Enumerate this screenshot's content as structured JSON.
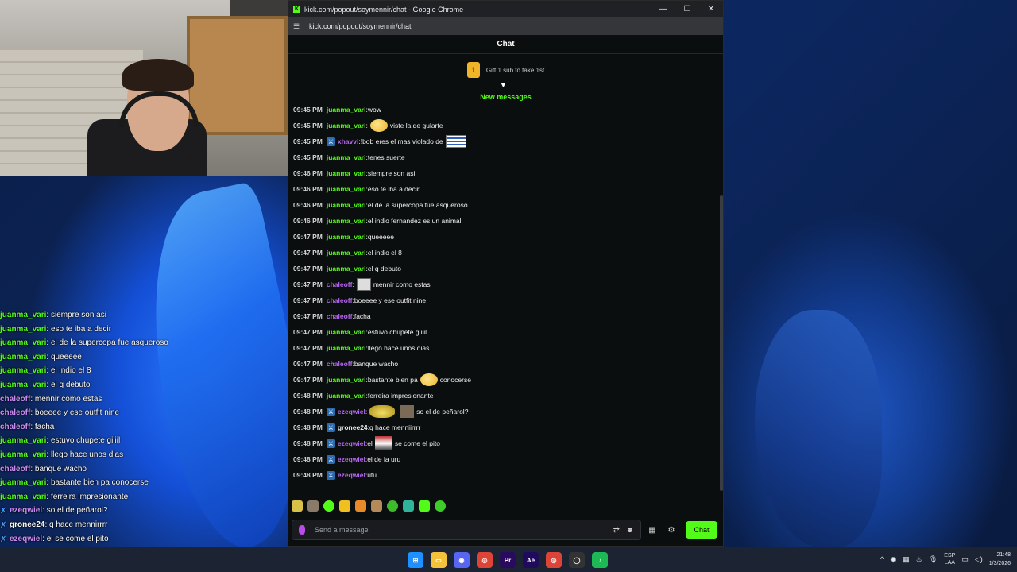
{
  "browser": {
    "title": "kick.com/popout/soymennir/chat - Google Chrome",
    "url": "kick.com/popout/soymennir/chat",
    "controls": {
      "minimize": "—",
      "maximize": "☐",
      "close": "✕"
    }
  },
  "chat": {
    "header": "Chat",
    "gift_rank": "1",
    "gift_text": "Gift 1 sub to take 1st",
    "new_messages": "New messages",
    "input_placeholder": "Send a message",
    "send_label": "Chat",
    "messages": [
      {
        "time": "09:45 PM",
        "user": "juanma_vari",
        "color": "#53fc18",
        "mod": false,
        "pre": "",
        "emote": "",
        "text": "wow"
      },
      {
        "time": "09:45 PM",
        "user": "juanma_vari",
        "color": "#53fc18",
        "mod": false,
        "pre": "",
        "emote": "blob",
        "text": "viste la de gularte"
      },
      {
        "time": "09:45 PM",
        "user": "xhavvi",
        "color": "#b565f0",
        "mod": true,
        "pre": "",
        "text": "!bob eres el mas violado de",
        "emote_after": "flag"
      },
      {
        "time": "09:45 PM",
        "user": "juanma_vari",
        "color": "#53fc18",
        "mod": false,
        "pre": "",
        "emote": "",
        "text": "tenes suerte"
      },
      {
        "time": "09:46 PM",
        "user": "juanma_vari",
        "color": "#53fc18",
        "mod": false,
        "pre": "",
        "emote": "",
        "text": "siempre son asi"
      },
      {
        "time": "09:46 PM",
        "user": "juanma_vari",
        "color": "#53fc18",
        "mod": false,
        "pre": "",
        "emote": "",
        "text": "eso te iba a decir"
      },
      {
        "time": "09:46 PM",
        "user": "juanma_vari",
        "color": "#53fc18",
        "mod": false,
        "pre": "",
        "emote": "",
        "text": "el de la supercopa fue asqueroso"
      },
      {
        "time": "09:46 PM",
        "user": "juanma_vari",
        "color": "#53fc18",
        "mod": false,
        "pre": "",
        "emote": "",
        "text": "el indio fernandez es un animal"
      },
      {
        "time": "09:47 PM",
        "user": "juanma_vari",
        "color": "#53fc18",
        "mod": false,
        "pre": "",
        "emote": "",
        "text": "queeeee"
      },
      {
        "time": "09:47 PM",
        "user": "juanma_vari",
        "color": "#53fc18",
        "mod": false,
        "pre": "",
        "emote": "",
        "text": "el indio el 8"
      },
      {
        "time": "09:47 PM",
        "user": "juanma_vari",
        "color": "#53fc18",
        "mod": false,
        "pre": "",
        "emote": "",
        "text": "el q debuto"
      },
      {
        "time": "09:47 PM",
        "user": "chaleoff",
        "color": "#b565f0",
        "mod": false,
        "pre": "",
        "emote": "cat",
        "text": "mennir como estas"
      },
      {
        "time": "09:47 PM",
        "user": "chaleoff",
        "color": "#b565f0",
        "mod": false,
        "pre": "",
        "emote": "",
        "text": "boeeee y ese outfit nine"
      },
      {
        "time": "09:47 PM",
        "user": "chaleoff",
        "color": "#b565f0",
        "mod": false,
        "pre": "",
        "emote": "",
        "text": "facha"
      },
      {
        "time": "09:47 PM",
        "user": "juanma_vari",
        "color": "#53fc18",
        "mod": false,
        "pre": "",
        "emote": "",
        "text": "estuvo chupete giiiil"
      },
      {
        "time": "09:47 PM",
        "user": "juanma_vari",
        "color": "#53fc18",
        "mod": false,
        "pre": "",
        "emote": "",
        "text": "llego hace unos dias"
      },
      {
        "time": "09:47 PM",
        "user": "chaleoff",
        "color": "#b565f0",
        "mod": false,
        "pre": "",
        "emote": "",
        "text": "banque wacho"
      },
      {
        "time": "09:47 PM",
        "user": "juanma_vari",
        "color": "#53fc18",
        "mod": false,
        "pre": "bastante bien pa",
        "emote": "blob",
        "text": "conocerse"
      },
      {
        "time": "09:48 PM",
        "user": "juanma_vari",
        "color": "#53fc18",
        "mod": false,
        "pre": "",
        "emote": "",
        "text": "ferreira impresionante"
      },
      {
        "time": "09:48 PM",
        "user": "ezeqwiel",
        "color": "#b565f0",
        "mod": true,
        "pre": "",
        "emote": "pen",
        "emote2": "dog",
        "text": "so el de peñarol?"
      },
      {
        "time": "09:48 PM",
        "user": "gronee24",
        "color": "#e8e8e8",
        "mod": true,
        "pre": "",
        "emote": "",
        "text": "q hace menniirrrr"
      },
      {
        "time": "09:48 PM",
        "user": "ezeqwiel",
        "color": "#b565f0",
        "mod": true,
        "pre": "el",
        "emote": "bag",
        "text": "se come el pito"
      },
      {
        "time": "09:48 PM",
        "user": "ezeqwiel",
        "color": "#b565f0",
        "mod": true,
        "pre": "",
        "emote": "",
        "text": "el de la uru"
      },
      {
        "time": "09:48 PM",
        "user": "ezeqwiel",
        "color": "#b565f0",
        "mod": true,
        "pre": "",
        "emote": "",
        "text": "utu"
      }
    ]
  },
  "overlay": {
    "rows": [
      {
        "user": "juanma_vari",
        "color": "#53fc18",
        "mod": false,
        "text": "siempre son asi"
      },
      {
        "user": "juanma_vari",
        "color": "#53fc18",
        "mod": false,
        "text": "eso te iba a decir"
      },
      {
        "user": "juanma_vari",
        "color": "#53fc18",
        "mod": false,
        "text": "el de la supercopa fue asqueroso"
      },
      {
        "user": "juanma_vari",
        "color": "#53fc18",
        "mod": false,
        "text": "queeeee"
      },
      {
        "user": "juanma_vari",
        "color": "#53fc18",
        "mod": false,
        "text": "el indio el 8"
      },
      {
        "user": "juanma_vari",
        "color": "#53fc18",
        "mod": false,
        "text": "el q debuto"
      },
      {
        "user": "chaleoff",
        "color": "#c98df5",
        "mod": false,
        "text": "mennir como estas"
      },
      {
        "user": "chaleoff",
        "color": "#c98df5",
        "mod": false,
        "text": "boeeee y ese outfit nine"
      },
      {
        "user": "chaleoff",
        "color": "#c98df5",
        "mod": false,
        "text": "facha"
      },
      {
        "user": "juanma_vari",
        "color": "#53fc18",
        "mod": false,
        "text": "estuvo chupete giiiil"
      },
      {
        "user": "juanma_vari",
        "color": "#53fc18",
        "mod": false,
        "text": "llego hace unos dias"
      },
      {
        "user": "chaleoff",
        "color": "#c98df5",
        "mod": false,
        "text": "banque wacho"
      },
      {
        "user": "juanma_vari",
        "color": "#53fc18",
        "mod": false,
        "text": "bastante bien pa conocerse"
      },
      {
        "user": "juanma_vari",
        "color": "#53fc18",
        "mod": false,
        "text": "ferreira impresionante"
      },
      {
        "user": "ezeqwiel",
        "color": "#c98df5",
        "mod": true,
        "text": "so el de peñarol?"
      },
      {
        "user": "gronee24",
        "color": "#ffffff",
        "mod": true,
        "text": "q hace mennirrrr"
      },
      {
        "user": "ezeqwiel",
        "color": "#c98df5",
        "mod": true,
        "text": "el se come el pito"
      },
      {
        "user": "ezeqwiel",
        "color": "#c98df5",
        "mod": true,
        "text": "el de la uru"
      },
      {
        "user": "ezeqwiel",
        "color": "#c98df5",
        "mod": true,
        "text": "utu"
      }
    ]
  },
  "taskbar": {
    "apps": [
      {
        "name": "windows-start-icon",
        "bg": "#1e90ff",
        "glyph": "⊞"
      },
      {
        "name": "file-explorer-icon",
        "bg": "#f3c13a",
        "glyph": "▭"
      },
      {
        "name": "discord-icon",
        "bg": "#5865f2",
        "glyph": "◉"
      },
      {
        "name": "chrome-icon",
        "bg": "#db4437",
        "glyph": "◎"
      },
      {
        "name": "premiere-icon",
        "bg": "#2a0a5e",
        "glyph": "Pr"
      },
      {
        "name": "after-effects-icon",
        "bg": "#1f0a5e",
        "glyph": "Ae"
      },
      {
        "name": "chrome-active-icon",
        "bg": "#db4437",
        "glyph": "◎"
      },
      {
        "name": "obs-icon",
        "bg": "#333333",
        "glyph": "◯"
      },
      {
        "name": "spotify-icon",
        "bg": "#1db954",
        "glyph": "♪"
      }
    ],
    "lang_top": "ESP",
    "lang_bottom": "LAA",
    "time": "21:48",
    "date": "1/3/2026"
  }
}
